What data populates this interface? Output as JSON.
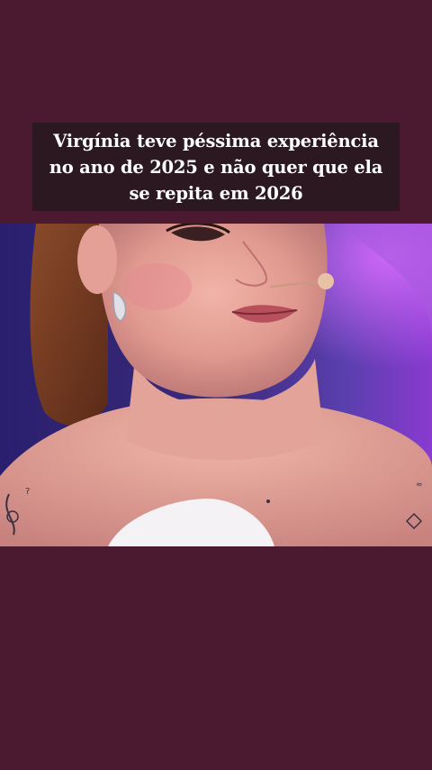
{
  "caption": {
    "lines": [
      "Virgínia teve péssima experiência",
      "no ano de 2025 e não quer que ela",
      "se repita em 2026"
    ]
  },
  "colors": {
    "background": "#4b1a31",
    "caption_background": "#2c1820",
    "caption_text": "#ffffff"
  },
  "photo": {
    "subject": "video-still-woman-close-up"
  }
}
